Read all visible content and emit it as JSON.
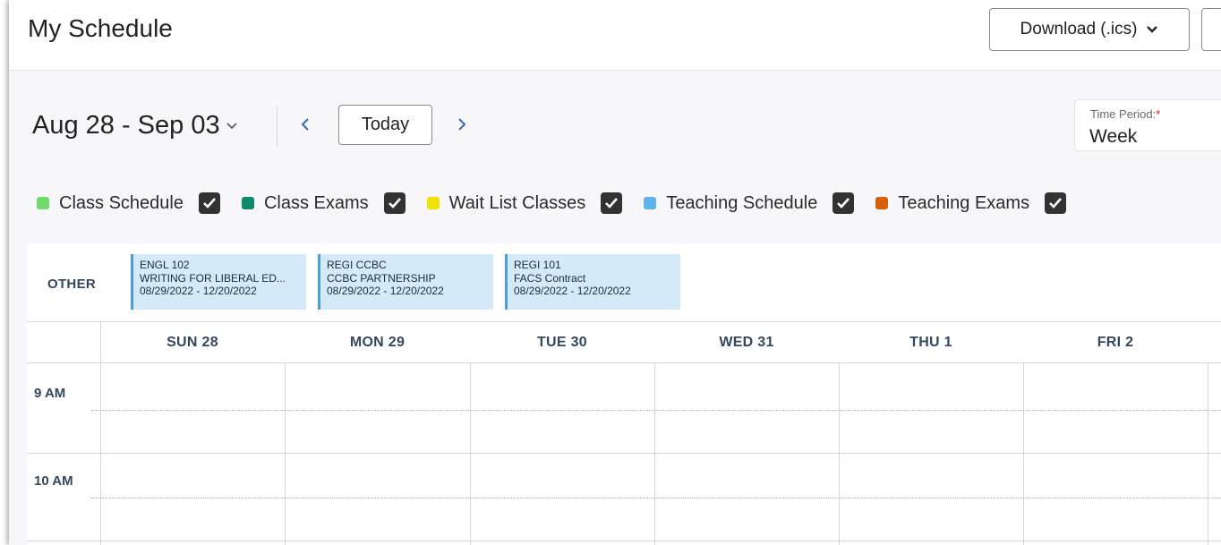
{
  "header": {
    "title": "My Schedule",
    "download_label": "Download (.ics)",
    "download_icon": "chevron-down-icon"
  },
  "toolbar": {
    "date_range": "Aug 28 - Sep 03",
    "today_label": "Today",
    "prev_icon": "chevron-left-icon",
    "next_icon": "chevron-right-icon",
    "time_period_label": "Time Period:",
    "time_period_required": "*",
    "time_period_value": "Week"
  },
  "legend": [
    {
      "label": "Class Schedule",
      "color": "#6fdb6f",
      "checked": true
    },
    {
      "label": "Class Exams",
      "color": "#0d8a6a",
      "checked": true
    },
    {
      "label": "Wait List Classes",
      "color": "#f2e200",
      "checked": true
    },
    {
      "label": "Teaching Schedule",
      "color": "#5cb3ea",
      "checked": true
    },
    {
      "label": "Teaching Exams",
      "color": "#d65f0c",
      "checked": true
    }
  ],
  "other": {
    "label": "OTHER",
    "events": [
      {
        "code": "ENGL 102",
        "title": "WRITING FOR LIBERAL ED...",
        "dates": "08/29/2022 - 12/20/2022"
      },
      {
        "code": "REGI CCBC",
        "title": "CCBC PARTNERSHIP",
        "dates": "08/29/2022 - 12/20/2022"
      },
      {
        "code": "REGI 101",
        "title": "FACS Contract",
        "dates": "08/29/2022 - 12/20/2022"
      }
    ]
  },
  "calendar": {
    "days": [
      "SUN 28",
      "MON 29",
      "TUE 30",
      "WED 31",
      "THU 1",
      "FRI 2"
    ],
    "hours": [
      "9 AM",
      "10 AM"
    ]
  }
}
